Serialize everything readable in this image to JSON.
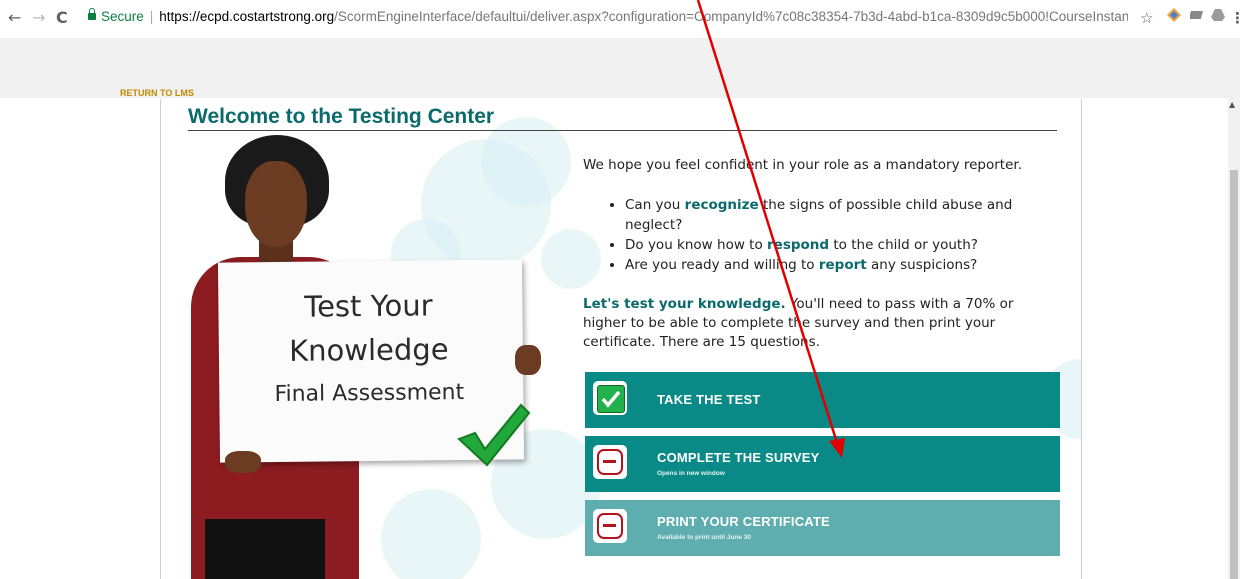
{
  "browser": {
    "back": "←",
    "forward": "→",
    "reload": "C",
    "secure_label": "Secure",
    "url_host": "https://ecpd.costartstrong.org",
    "url_path": "/ScormEngineInterface/defaultui/deliver.aspx?configuration=CompanyId%7c08c38354-7b3d-4abd-b1ca-8309d9c5b000!CourseInstanc...",
    "star": "☆",
    "menu": "⋮"
  },
  "header": {
    "return_lms": "RETURN TO LMS"
  },
  "page": {
    "title": "Welcome to the Testing Center",
    "intro": "We hope you feel confident in your role as a mandatory reporter.",
    "bullets": [
      {
        "pre": "Can you ",
        "kw": "recognize",
        "post": " the signs of possible child abuse and neglect?"
      },
      {
        "pre": "Do you know how to ",
        "kw": "respond",
        "post": " to the child or youth?"
      },
      {
        "pre": "Are you ready and willing to ",
        "kw": "report",
        "post": " any suspicions?"
      }
    ],
    "para_kw": "Let's test your knowledge.",
    "para_rest": " You'll need to pass with a 70% or higher to be able to complete the survey and then print your certificate. There are 15 questions."
  },
  "sign": {
    "line1": "Test Your",
    "line2": "Knowledge",
    "line3": "Final Assessment"
  },
  "actions": [
    {
      "label": "TAKE THE TEST",
      "sub": "",
      "status": "done"
    },
    {
      "label": "COMPLETE THE SURVEY",
      "sub": "Opens in new window",
      "status": "locked"
    },
    {
      "label": "PRINT YOUR CERTIFICATE",
      "sub": "Available to print until June 30",
      "status": "locked"
    }
  ],
  "colors": {
    "accent": "#0a8a87",
    "title": "#0b6b6c",
    "return_lms": "#c28b00",
    "annotation": "#e00000"
  }
}
